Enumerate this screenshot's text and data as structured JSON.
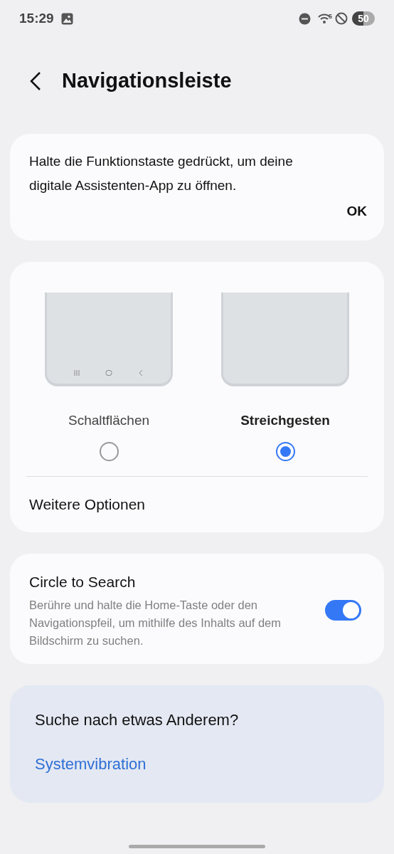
{
  "status_bar": {
    "time": "15:29",
    "wifi_label": "5",
    "battery": "50"
  },
  "header": {
    "title": "Navigationsleiste"
  },
  "tip": {
    "text": "Halte die Funktionstaste gedrückt, um deine digitale Assistenten-App zu öffnen.",
    "button": "OK"
  },
  "nav_types": [
    {
      "label": "Schaltflächen",
      "kind": "buttons",
      "selected": false
    },
    {
      "label": "Streichgesten",
      "kind": "gestures",
      "selected": true
    }
  ],
  "more_options": "Weitere Optionen",
  "circle_to_search": {
    "title": "Circle to Search",
    "description": "Berühre und halte die Home-Taste oder den Navigationspfeil, um mithilfe des Inhalts auf dem Bildschirm zu suchen.",
    "on": true
  },
  "suggestion": {
    "title": "Suche nach etwas Anderem?",
    "link": "Systemvibration"
  }
}
